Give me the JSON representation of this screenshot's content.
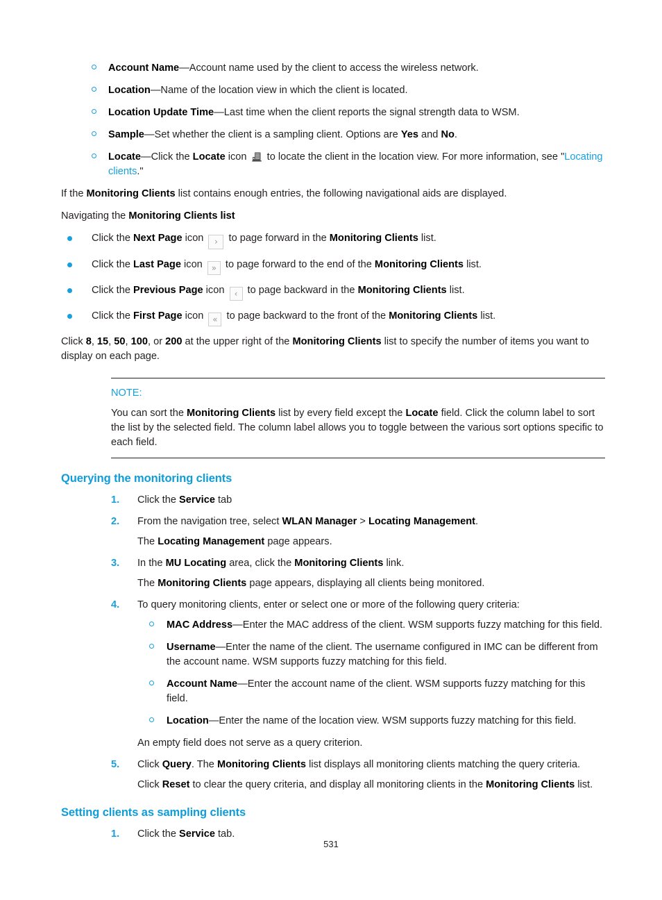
{
  "document": {
    "page_number": "531"
  },
  "field_descriptions": {
    "items": [
      {
        "term": "Account Name",
        "dash": "—",
        "text": "Account name used by the client to access the wireless network."
      },
      {
        "term": "Location",
        "dash": "—",
        "text": "Name of the location view in which the client is located."
      },
      {
        "term": "Location Update Time",
        "dash": "—",
        "text": "Last time when the client reports the signal strength data to WSM."
      },
      {
        "term": "Sample",
        "dash": "—",
        "text_before": "Set whether the client is a sampling client. Options are ",
        "option_yes": "Yes",
        "text_middle": " and ",
        "option_no": "No",
        "text_after": "."
      },
      {
        "term": "Locate",
        "dash": "—",
        "text_before": "Click the ",
        "bold_inline": "Locate",
        "text_icon_label": " icon ",
        "icon": "locate-building-icon",
        "text_after": " to locate the client in the location view. For more information, see \"",
        "link_text": "Locating clients",
        "text_end": ".\""
      }
    ]
  },
  "nav_intro": {
    "text_before": "If the ",
    "bold1": "Monitoring Clients",
    "text_after": " list contains enough entries, the following navigational aids are displayed.",
    "subtitle_before": "Navigating the ",
    "subtitle_bold": "Monitoring Clients list"
  },
  "nav_aids": {
    "items": [
      {
        "text_before": "Click the ",
        "bold": "Next Page",
        "text_icon": " icon ",
        "icon": "next-page-icon",
        "glyph": "›",
        "text_mid": " to page forward in the ",
        "bold2": "Monitoring Clients",
        "text_after": " list."
      },
      {
        "text_before": "Click the ",
        "bold": "Last Page",
        "text_icon": " icon ",
        "icon": "last-page-icon",
        "glyph": "»",
        "text_mid": " to page forward to the end of the ",
        "bold2": "Monitoring Clients",
        "text_after": " list."
      },
      {
        "text_before": "Click the ",
        "bold": "Previous Page",
        "text_icon": " icon ",
        "icon": "previous-page-icon",
        "glyph": "‹",
        "text_mid": " to page backward in the ",
        "bold2": "Monitoring Clients",
        "text_after": " list."
      },
      {
        "text_before": "Click the ",
        "bold": "First Page",
        "text_icon": " icon ",
        "icon": "first-page-icon",
        "glyph": "«",
        "text_mid": " to page backward to the front of the ",
        "bold2": "Monitoring Clients",
        "text_after": " list."
      }
    ]
  },
  "page_size_paragraph": {
    "text_start": "Click ",
    "sizes": [
      "8",
      "15",
      "50",
      "100",
      "200"
    ],
    "sep": ", ",
    "or_word": ", or ",
    "text_mid": " at the upper right of the ",
    "bold": "Monitoring Clients",
    "text_end": " list to specify the number of items you want to display on each page."
  },
  "note": {
    "label": "NOTE:",
    "text_start": "You can sort the ",
    "bold1": "Monitoring Clients",
    "text_mid": " list by every field except the ",
    "bold2": "Locate",
    "text_end": " field. Click the column label to sort the list by the selected field. The column label allows you to toggle between the various sort options specific to each field."
  },
  "section_query": {
    "heading": "Querying the monitoring clients",
    "steps": [
      {
        "num": "1.",
        "text_before": "Click the ",
        "bold": "Service",
        "text_after": " tab"
      },
      {
        "num": "2.",
        "text_before": "From the navigation tree, select ",
        "bold": "WLAN Manager",
        "text_mid": " > ",
        "bold2": "Locating Management",
        "text_after": ".",
        "continuation_before": "The ",
        "continuation_bold": "Locating Management",
        "continuation_after": " page appears."
      },
      {
        "num": "3.",
        "text_before": "In the ",
        "bold": "MU Locating",
        "text_mid": " area, click the ",
        "bold2": "Monitoring Clients",
        "text_after": " link.",
        "continuation_before": "The ",
        "continuation_bold": "Monitoring Clients",
        "continuation_after": " page appears, displaying all clients being monitored."
      },
      {
        "num": "4.",
        "text": "To query monitoring clients, enter or select one or more of the following query criteria:",
        "criteria": [
          {
            "term": "MAC Address",
            "dash": "—",
            "text": "Enter the MAC address of the client. WSM supports fuzzy matching for this field."
          },
          {
            "term": "Username",
            "dash": "—",
            "text": "Enter the name of the client. The username configured in IMC can be different from the account name. WSM supports fuzzy matching for this field."
          },
          {
            "term": "Account Name",
            "dash": "—",
            "text": "Enter the account name of the client. WSM supports fuzzy matching for this field."
          },
          {
            "term": "Location",
            "dash": "—",
            "text": "Enter the name of the location view. WSM supports fuzzy matching for this field."
          }
        ],
        "footnote": "An empty field does not serve as a query criterion."
      },
      {
        "num": "5.",
        "text_before": "Click ",
        "bold": "Query",
        "text_mid": ". The ",
        "bold2": "Monitoring Clients",
        "text_after": " list displays all monitoring clients matching the query criteria.",
        "continuation_before": "Click ",
        "continuation_bold": "Reset",
        "continuation_mid": " to clear the query criteria, and display all monitoring clients in the ",
        "continuation_bold2": "Monitoring Clients",
        "continuation_after": " list."
      }
    ]
  },
  "section_sampling": {
    "heading": "Setting clients as sampling clients",
    "steps": [
      {
        "num": "1.",
        "text_before": "Click the ",
        "bold": "Service",
        "text_after": " tab."
      }
    ]
  },
  "colors": {
    "accent_blue": "#0e9dd9",
    "link_blue": "#16a0dc",
    "body_text": "#231f20"
  }
}
